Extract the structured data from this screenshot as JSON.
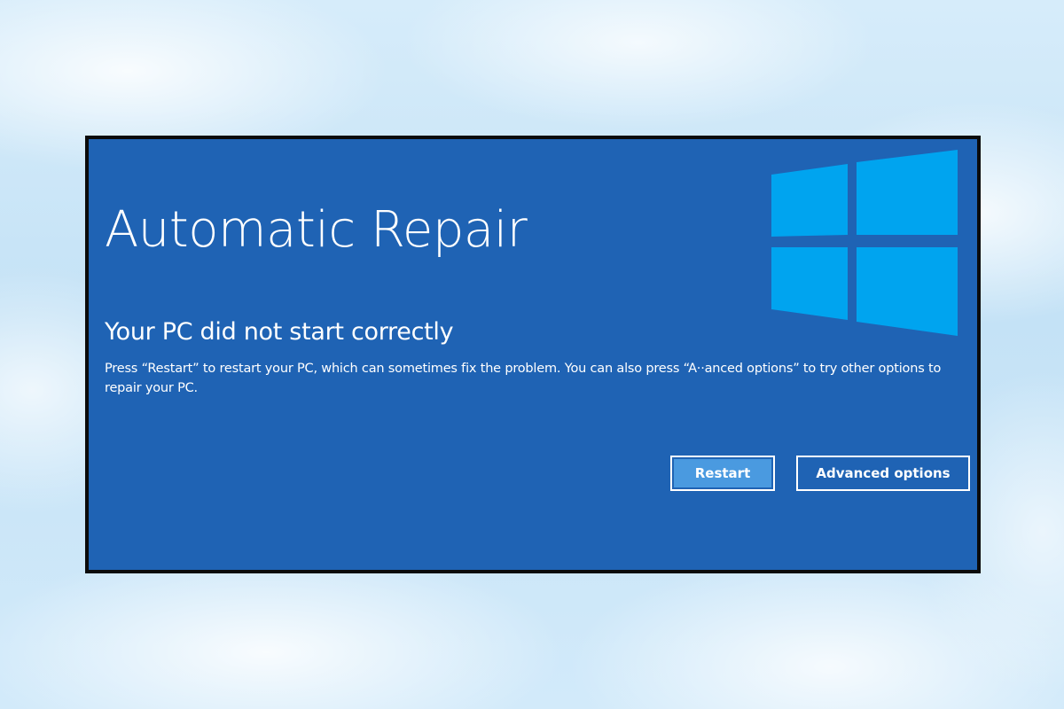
{
  "screen": {
    "title": "Automatic Repair",
    "subtitle": "Your PC did not start correctly",
    "message": "Press “Restart” to restart your PC, which can sometimes fix the problem. You can also press “A··anced options” to try other options to repair your PC.",
    "logo_icon": "windows-logo-icon",
    "logo_color": "#00a4ef",
    "background_color": "#1f63b4"
  },
  "buttons": {
    "restart_label": "Restart",
    "advanced_label": "Advanced options",
    "restart_color": "#4a9ae0"
  }
}
